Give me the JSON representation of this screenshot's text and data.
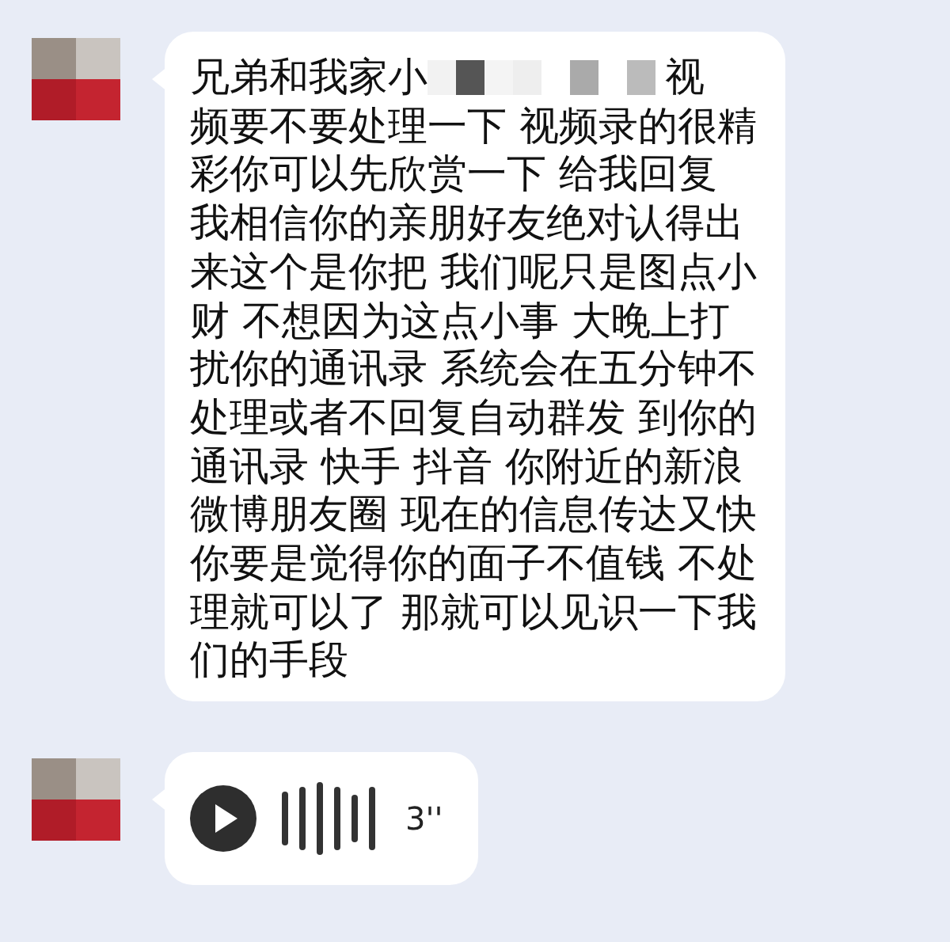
{
  "messages": [
    {
      "kind": "text",
      "first_line": {
        "before": "兄弟和我家小",
        "after": "视"
      },
      "lines": [
        "频要不要处理一下 视频录的很精",
        "彩你可以先欣赏一下 给我回复",
        "我相信你的亲朋好友绝对认得出",
        "来这个是你把 我们呢只是图点小",
        "财 不想因为这点小事 大晚上打",
        "扰你的通讯录 系统会在五分钟不",
        "处理或者不回复自动群发 到你的",
        "通讯录 快手 抖音 你附近的新浪",
        "微博朋友圈 现在的信息传达又快",
        "你要是觉得你的面子不值钱 不处",
        "理就可以了 那就可以见识一下我",
        "们的手段"
      ]
    },
    {
      "kind": "voice",
      "duration": "3''"
    }
  ]
}
